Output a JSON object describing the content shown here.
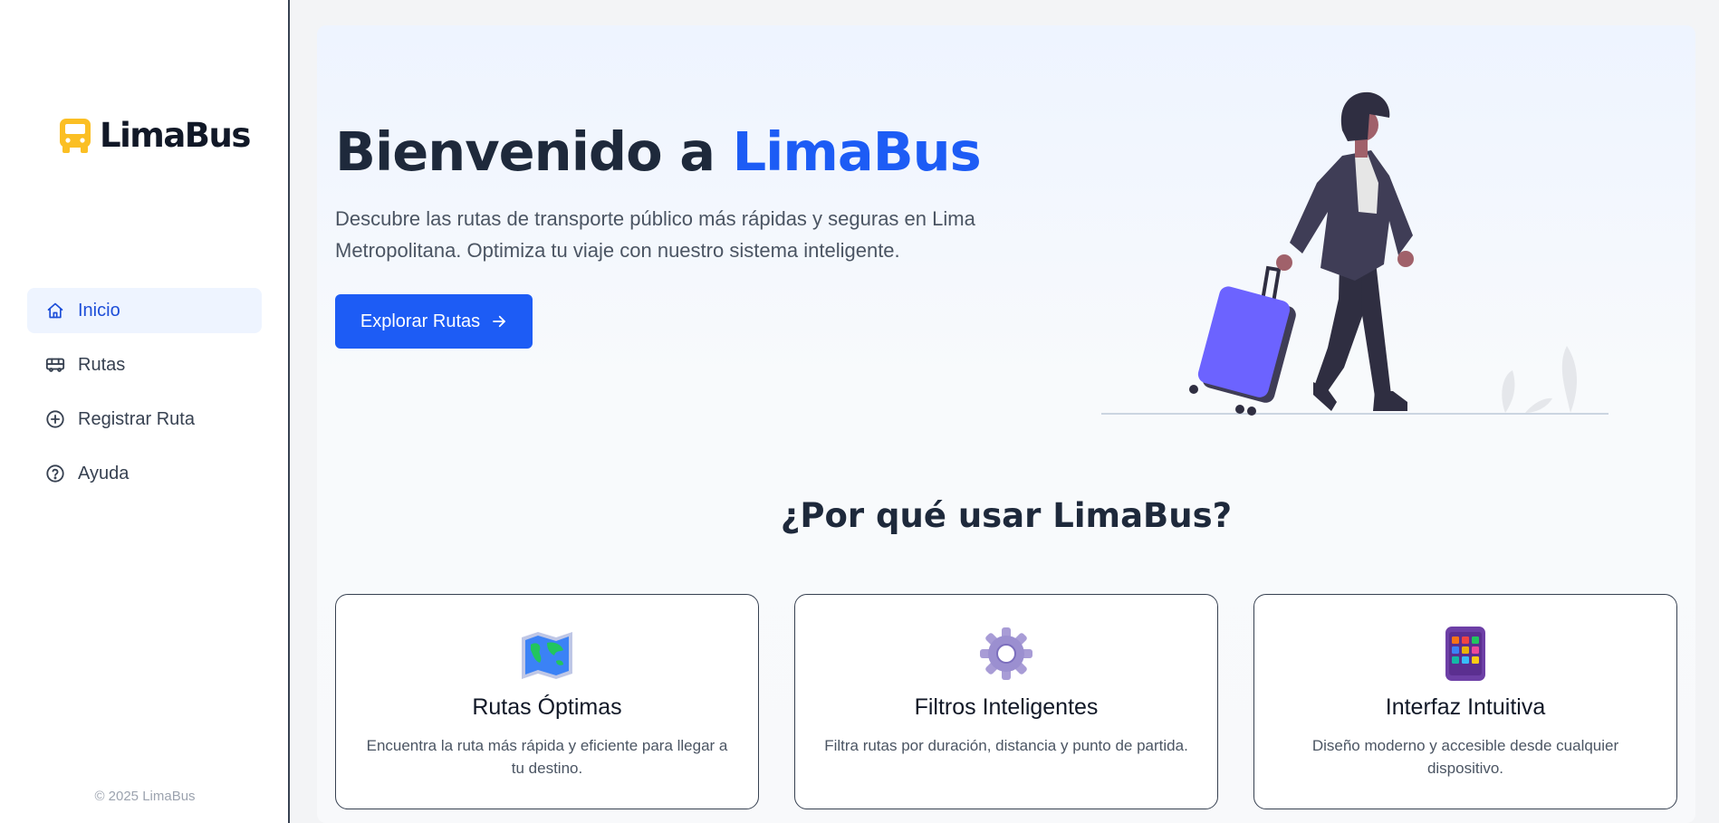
{
  "sidebar": {
    "logo_text": "LimaBus",
    "logo_icon": "bus-icon",
    "items": [
      {
        "label": "Inicio",
        "icon": "home-icon",
        "active": true
      },
      {
        "label": "Rutas",
        "icon": "bus-icon",
        "active": false
      },
      {
        "label": "Registrar Ruta",
        "icon": "plus-circle-icon",
        "active": false
      },
      {
        "label": "Ayuda",
        "icon": "help-circle-icon",
        "active": false
      }
    ],
    "copyright": "© 2025 LimaBus"
  },
  "hero": {
    "title_prefix": "Bienvenido a ",
    "title_brand": "LimaBus",
    "description": "Descubre las rutas de transporte público más rápidas y seguras en Lima Metropolitana. Optimiza tu viaje con nuestro sistema inteligente.",
    "cta_label": "Explorar Rutas",
    "cta_icon": "arrow-right-icon"
  },
  "features": {
    "title": "¿Por qué usar LimaBus?",
    "cards": [
      {
        "icon": "world-map-icon",
        "title": "Rutas Óptimas",
        "description": "Encuentra la ruta más rápida y eficiente para llegar a tu destino."
      },
      {
        "icon": "gear-icon",
        "title": "Filtros Inteligentes",
        "description": "Filtra rutas por duración, distancia y punto de partida."
      },
      {
        "icon": "mobile-phone-icon",
        "title": "Interfaz Intuitiva",
        "description": "Diseño moderno y accesible desde cualquier dispositivo."
      }
    ]
  },
  "colors": {
    "accent": "#1d5cf5",
    "logo_yellow": "#fbbf24",
    "active_bg": "#eef4ff"
  }
}
